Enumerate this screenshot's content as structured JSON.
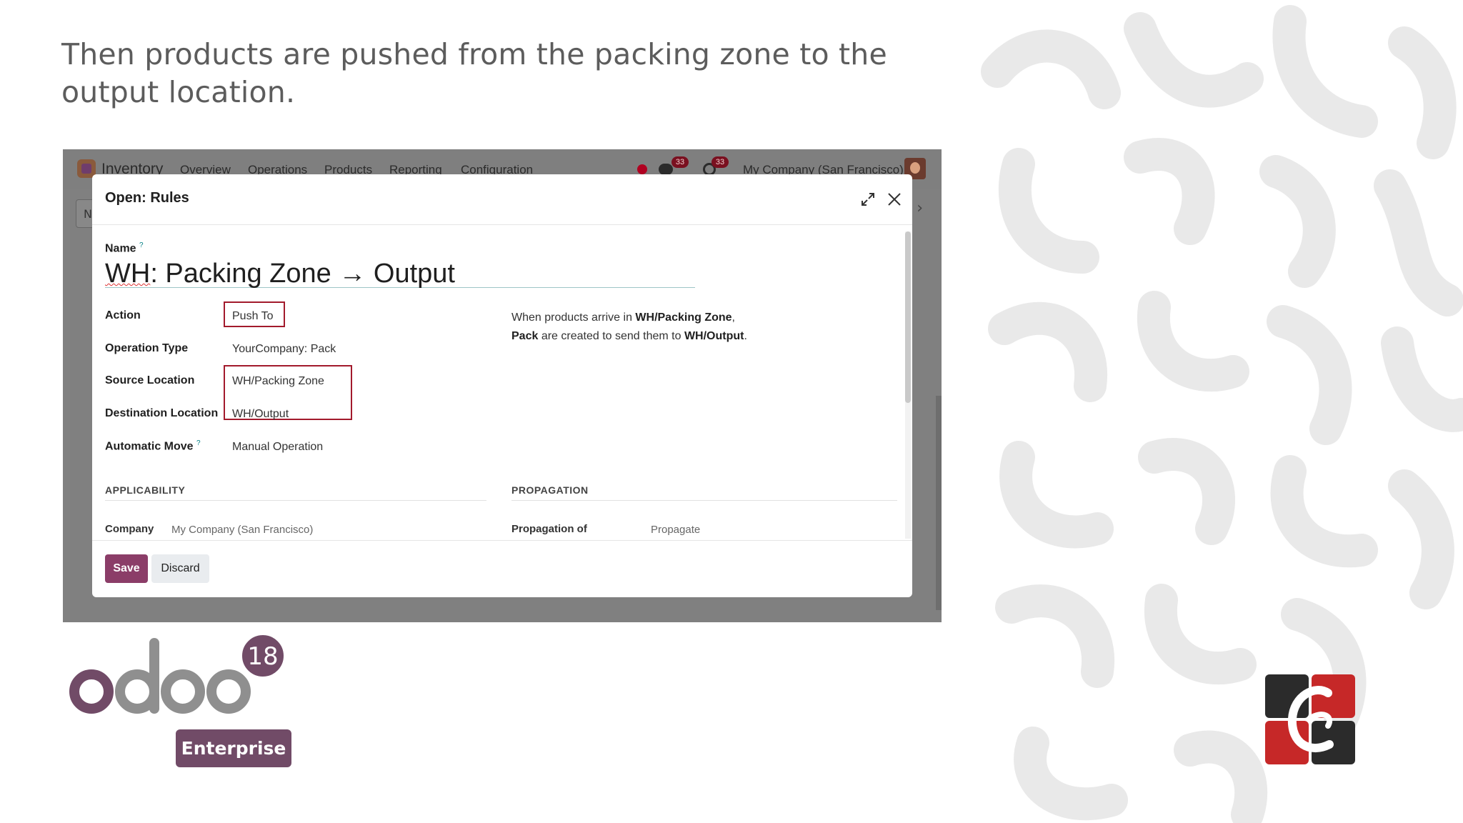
{
  "slide": {
    "heading": "Then products are pushed  from the packing zone to the output location."
  },
  "topbar": {
    "app_name": "Inventory",
    "menu": [
      "Overview",
      "Operations",
      "Products",
      "Reporting",
      "Configuration"
    ],
    "chat_badge": "33",
    "activity_badge": "33",
    "company": "My Company (San Francisco)",
    "behind_button_text": "N"
  },
  "modal": {
    "title": "Open: Rules",
    "name_label": "Name",
    "name_help": "?",
    "name_value_prefix": "WH",
    "name_value_rest": ": Packing Zone → Output",
    "fields": {
      "action_label": "Action",
      "action_value": "Push To",
      "operation_type_label": "Operation Type",
      "operation_type_value": "YourCompany: Pack",
      "source_location_label": "Source Location",
      "source_location_value": "WH/Packing Zone",
      "destination_location_label": "Destination Location",
      "destination_location_value": "WH/Output",
      "automatic_move_label": "Automatic Move",
      "automatic_move_help": "?",
      "automatic_move_value": "Manual Operation"
    },
    "help_text": {
      "part1": "When products arrive in ",
      "part2": "WH/Packing Zone",
      "part3": ",",
      "part4": "Pack",
      "part5": " are created to send them to ",
      "part6": "WH/Output",
      "part7": "."
    },
    "sections": {
      "applicability": "APPLICABILITY",
      "propagation": "PROPAGATION",
      "company_label": "Company",
      "company_value": "My Company (San Francisco)",
      "propagation_label": "Propagation of",
      "propagation_value": "Propagate"
    },
    "buttons": {
      "save": "Save",
      "discard": "Discard"
    }
  },
  "branding": {
    "odoo_version": "18",
    "edition": "Enterprise",
    "odoo_wordmark": "odoo",
    "colors": {
      "odoo_purple": "#714b67",
      "odoo_gray": "#8f8f8f",
      "highlight_red": "#a21a2c",
      "save_button": "#8b3d68"
    }
  }
}
